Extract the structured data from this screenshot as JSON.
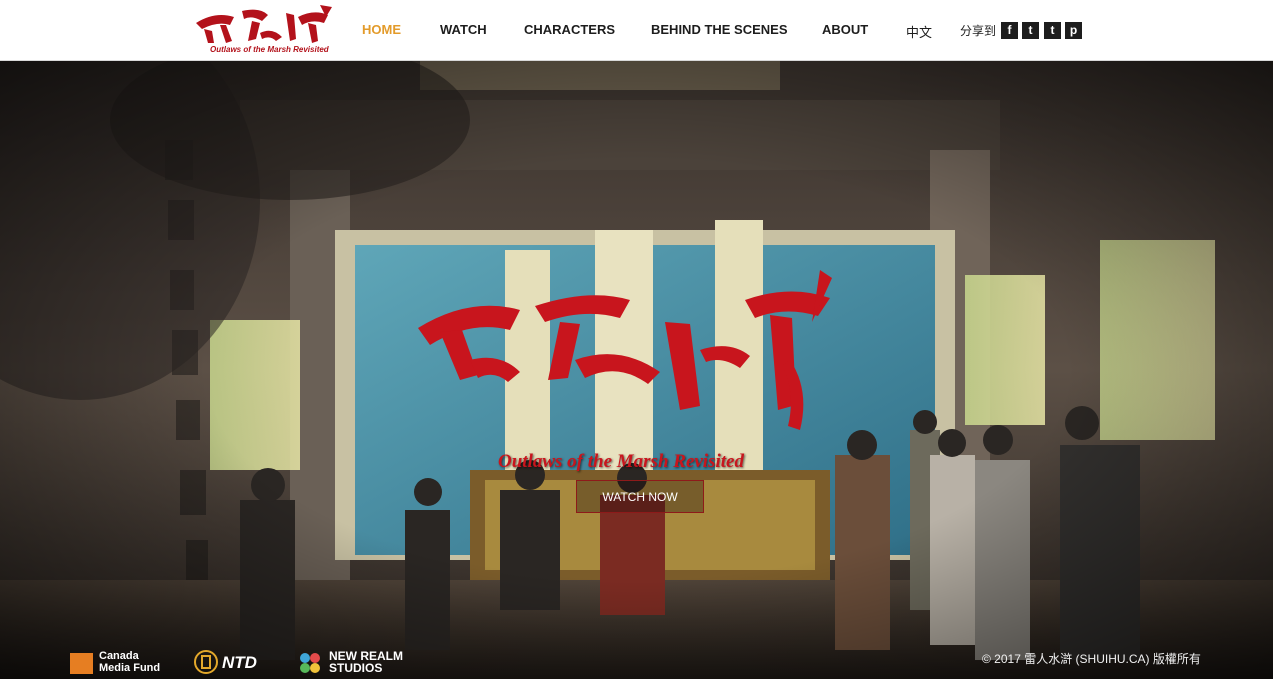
{
  "header": {
    "logo_sub": "Outlaws of the Marsh Revisited",
    "nav": [
      {
        "label": "HOME",
        "active": true
      },
      {
        "label": "WATCH",
        "active": false
      },
      {
        "label": "CHARACTERS",
        "active": false
      },
      {
        "label": "BEHIND THE SCENES",
        "active": false
      },
      {
        "label": "ABOUT",
        "active": false
      },
      {
        "label": "中文",
        "active": false
      }
    ],
    "share_label": "分享到",
    "share_buttons": [
      {
        "icon": "facebook-icon",
        "glyph": "f"
      },
      {
        "icon": "twitter-icon",
        "glyph": "t"
      },
      {
        "icon": "tumblr-icon",
        "glyph": "t"
      },
      {
        "icon": "pinterest-icon",
        "glyph": "p"
      }
    ],
    "active_color": "#e39b2b"
  },
  "hero": {
    "title_sub": "Outlaws of the Marsh Revisited",
    "cta_label": "WATCH NOW",
    "accent": "#c8151d"
  },
  "footer": {
    "sponsors": [
      {
        "label": "Canada\nMedia Fund"
      },
      {
        "label": "NTD"
      },
      {
        "label": "NEW REALM\nSTUDIOS"
      }
    ],
    "copyright": "© 2017 雷人水滸 (SHUIHU.CA) 版權所有"
  }
}
